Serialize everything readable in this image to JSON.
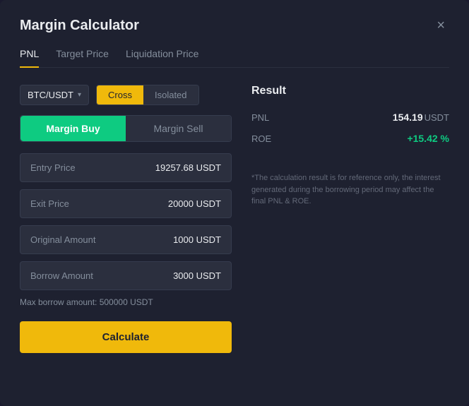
{
  "modal": {
    "title": "Margin Calculator",
    "close_label": "×"
  },
  "tabs": [
    {
      "label": "PNL",
      "active": true
    },
    {
      "label": "Target Price",
      "active": false
    },
    {
      "label": "Liquidation Price",
      "active": false
    }
  ],
  "pair_select": {
    "value": "BTC/USDT",
    "chevron": "▾"
  },
  "mode_buttons": {
    "cross": "Cross",
    "isolated": "Isolated"
  },
  "buy_sell": {
    "buy": "Margin Buy",
    "sell": "Margin Sell"
  },
  "fields": {
    "entry_price": {
      "label": "Entry Price",
      "value": "19257.68 USDT"
    },
    "exit_price": {
      "label": "Exit Price",
      "value": "20000 USDT"
    },
    "original_amount": {
      "label": "Original Amount",
      "value": "1000 USDT"
    },
    "borrow_amount": {
      "label": "Borrow Amount",
      "value": "3000 USDT"
    }
  },
  "max_borrow": "Max borrow amount: 500000 USDT",
  "calculate_btn": "Calculate",
  "result": {
    "title": "Result",
    "pnl_label": "PNL",
    "pnl_value": "154.19",
    "pnl_unit": "USDT",
    "roe_label": "ROE",
    "roe_value": "+15.42 %"
  },
  "disclaimer": "*The calculation result is for reference only, the interest generated during the borrowing period may affect the final PNL & ROE."
}
